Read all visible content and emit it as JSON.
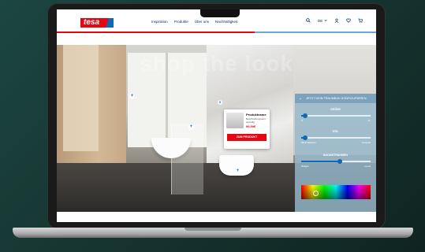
{
  "brand": {
    "logo_text": "tesa",
    "primary_color": "#e30613",
    "accent_color": "#0f68b3"
  },
  "nav": {
    "links": [
      "Inspiration",
      "Produkte",
      "Über uns",
      "Nachhaltigkeit"
    ],
    "language": "DE",
    "icons": [
      "search-icon",
      "chevron-down-icon",
      "user-icon",
      "heart-icon",
      "cart-icon"
    ]
  },
  "hero": {
    "watermark": "shop the look",
    "hotspots": [
      "+",
      "+",
      "+"
    ]
  },
  "product_card": {
    "marker": "1",
    "name": "Produktname",
    "description": "Beschreibungstext einzeilig",
    "price": "99,99€",
    "button_label": "ZUM PRODUKT"
  },
  "configurator": {
    "title": "JETZT DEIN TRAUMBAD KONFIGURIEREN",
    "sliders": [
      {
        "label": "GRÖßE",
        "min": "S",
        "max": "XL",
        "value": 0.06
      },
      {
        "label": "STIL",
        "min": "Minimalistisch",
        "max": "Verspielt",
        "value": 0.06
      },
      {
        "label": "BUDGETRAHMEN",
        "min": "Budget",
        "max": "Luxus",
        "value": 0.56
      }
    ],
    "color_picker": {
      "selected": 0.2
    }
  }
}
